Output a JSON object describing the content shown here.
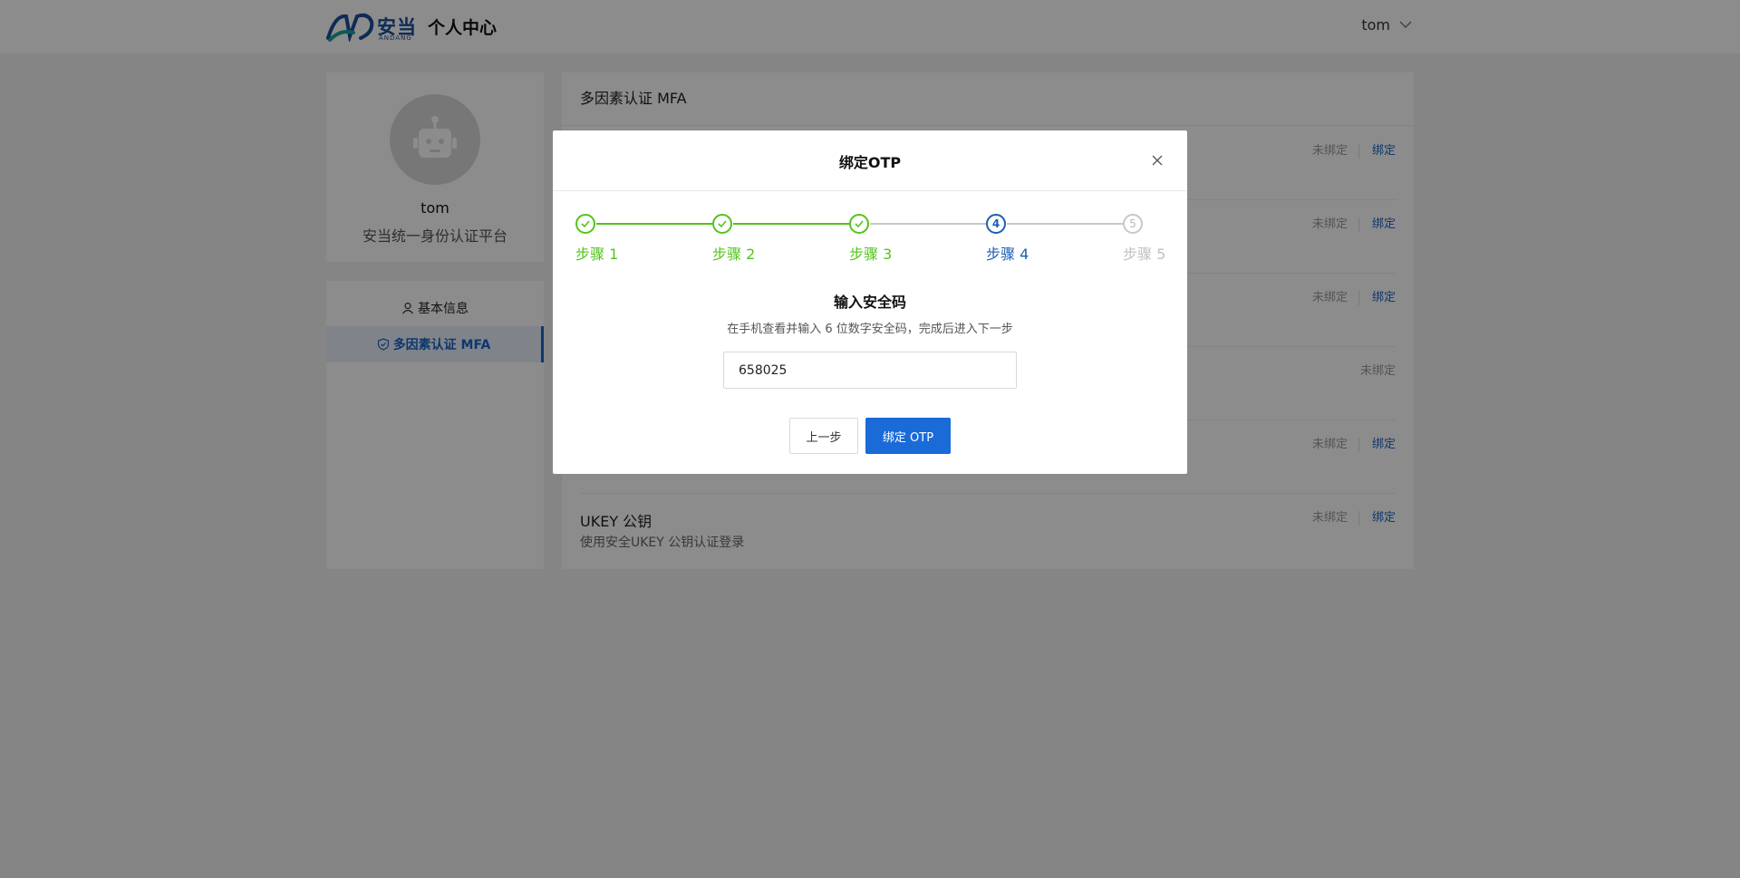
{
  "header": {
    "logo_text": "安当",
    "logo_sub": "ANDANG",
    "title": "个人中心",
    "username": "tom"
  },
  "profile": {
    "name": "tom",
    "org": "安当统一身份认证平台"
  },
  "nav": {
    "items": [
      {
        "label": "基本信息"
      },
      {
        "label": "多因素认证 MFA"
      }
    ]
  },
  "main": {
    "title": "多因素认证 MFA",
    "rows": [
      {
        "title": "",
        "desc": "",
        "status": "未绑定",
        "action": "绑定"
      },
      {
        "title": "",
        "desc": "",
        "status": "未绑定",
        "action": "绑定"
      },
      {
        "title": "",
        "desc": "",
        "status": "未绑定",
        "action": "绑定"
      },
      {
        "title": "",
        "desc": "",
        "status": "未绑定",
        "action": ""
      },
      {
        "title": "",
        "desc": "",
        "status": "未绑定",
        "action": "绑定"
      },
      {
        "title": "UKEY 公钥",
        "desc": "使用安全UKEY 公钥认证登录",
        "status": "未绑定",
        "action": "绑定"
      }
    ]
  },
  "modal": {
    "title": "绑定OTP",
    "steps": [
      {
        "label": "步骤 1",
        "status": "done"
      },
      {
        "label": "步骤 2",
        "status": "done"
      },
      {
        "label": "步骤 3",
        "status": "done"
      },
      {
        "label": "步骤 4",
        "status": "current",
        "number": "4"
      },
      {
        "label": "步骤 5",
        "status": "wait",
        "number": "5"
      }
    ],
    "content_title": "输入安全码",
    "content_desc": "在手机查看并输入 6 位数字安全码，完成后进入下一步",
    "code_value": "658025",
    "prev_label": "上一步",
    "bind_label": "绑定 OTP"
  },
  "colors": {
    "primary": "#1a6ad8",
    "success": "#52c41a",
    "current": "#1a5fb4",
    "wait": "#c0c0c0"
  }
}
